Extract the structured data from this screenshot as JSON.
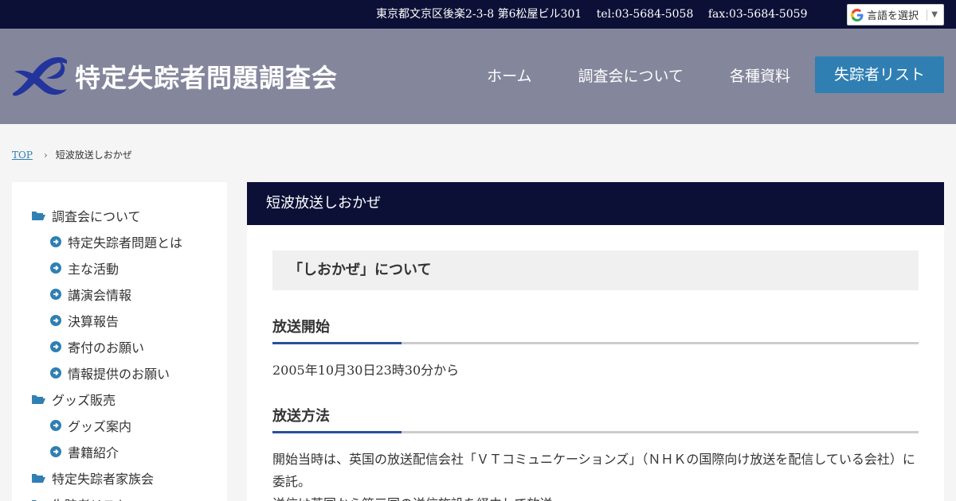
{
  "topbar": {
    "address": "東京都文京区後楽2-3-8 第6松屋ビル301",
    "tel": "tel:03-5684-5058",
    "fax": "fax:03-5684-5059"
  },
  "language_selector": {
    "label": "言語を選択",
    "arrow": "▼"
  },
  "brand": {
    "name": "特定失踪者問題調査会"
  },
  "nav": {
    "items": [
      {
        "label": "ホーム"
      },
      {
        "label": "調査会について"
      },
      {
        "label": "各種資料"
      }
    ],
    "cta_label": "失踪者リスト"
  },
  "breadcrumb": {
    "home": "TOP",
    "separator": "›",
    "current": "短波放送しおかぜ"
  },
  "sidebar": {
    "items": [
      {
        "label": "調査会について",
        "level": "category",
        "icon": "folder-open-icon"
      },
      {
        "label": "特定失踪者問題とは",
        "level": "sub",
        "icon": "arrow-circle-right-icon"
      },
      {
        "label": "主な活動",
        "level": "sub",
        "icon": "arrow-circle-right-icon"
      },
      {
        "label": "講演会情報",
        "level": "sub",
        "icon": "arrow-circle-right-icon"
      },
      {
        "label": "決算報告",
        "level": "sub",
        "icon": "arrow-circle-right-icon"
      },
      {
        "label": "寄付のお願い",
        "level": "sub",
        "icon": "arrow-circle-right-icon"
      },
      {
        "label": "情報提供のお願い",
        "level": "sub",
        "icon": "arrow-circle-right-icon"
      },
      {
        "label": "グッズ販売",
        "level": "category",
        "icon": "folder-open-icon"
      },
      {
        "label": "グッズ案内",
        "level": "sub",
        "icon": "arrow-circle-right-icon"
      },
      {
        "label": "書籍紹介",
        "level": "sub",
        "icon": "arrow-circle-right-icon"
      },
      {
        "label": "特定失踪者家族会",
        "level": "category",
        "icon": "folder-open-icon"
      },
      {
        "label": "失踪者リスト",
        "level": "category",
        "icon": "folder-open-icon"
      }
    ]
  },
  "main": {
    "title": "短波放送しおかぜ",
    "section_heading": "「しおかぜ」について",
    "subsections": [
      {
        "heading": "放送開始",
        "body": "2005年10月30日23時30分から"
      },
      {
        "heading": "放送方法",
        "body": "開始当時は、英国の放送配信会社「ＶＴコミュニケーションズ」（ＮＨＫの国際向け放送を配信している会社）に委託。",
        "body2": "送信は英国から第三国の送信施設を経由して放送。"
      }
    ]
  },
  "colors": {
    "topbar_bg": "#0c1036",
    "header_bg": "#84869c",
    "accent_blue": "#2f7fb3",
    "title_bar_bg": "#0c1036",
    "heading_accent": "#2a4f9c"
  }
}
